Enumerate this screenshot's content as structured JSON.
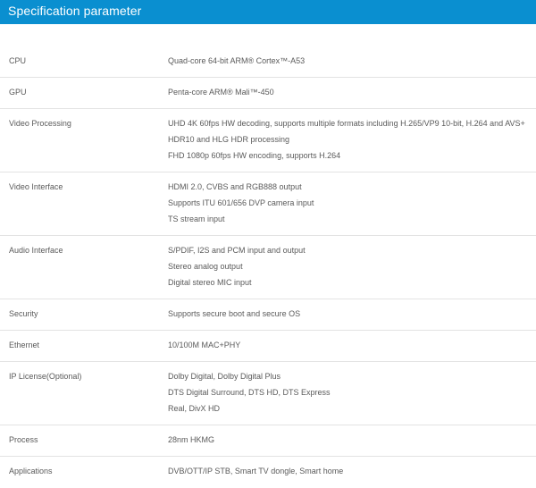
{
  "header": {
    "title": "Specification parameter"
  },
  "specs": [
    {
      "label": "CPU",
      "values": [
        "Quad-core 64-bit ARM® Cortex™-A53"
      ]
    },
    {
      "label": "GPU",
      "values": [
        "Penta-core ARM® Mali™-450"
      ]
    },
    {
      "label": "Video Processing",
      "values": [
        "UHD 4K 60fps HW decoding, supports multiple formats including H.265/VP9 10-bit, H.264 and AVS+",
        "HDR10 and HLG HDR processing",
        "FHD 1080p 60fps HW encoding, supports H.264"
      ]
    },
    {
      "label": "Video Interface",
      "values": [
        "HDMI 2.0, CVBS and RGB888 output",
        "Supports ITU 601/656 DVP camera input",
        "TS stream input"
      ]
    },
    {
      "label": "Audio Interface",
      "values": [
        "S/PDIF, I2S and PCM input and output",
        "Stereo analog output",
        "Digital stereo MIC input"
      ]
    },
    {
      "label": "Security",
      "values": [
        "Supports secure boot and secure OS"
      ]
    },
    {
      "label": "Ethernet",
      "values": [
        "10/100M MAC+PHY"
      ]
    },
    {
      "label": "IP License(Optional)",
      "values": [
        "Dolby Digital, Dolby Digital Plus",
        "DTS Digital Surround, DTS HD, DTS Express",
        "Real, DivX HD"
      ]
    },
    {
      "label": "Process",
      "values": [
        "28nm HKMG"
      ]
    },
    {
      "label": "Applications",
      "values": [
        "DVB/OTT/IP STB, Smart TV dongle, Smart home"
      ]
    }
  ]
}
